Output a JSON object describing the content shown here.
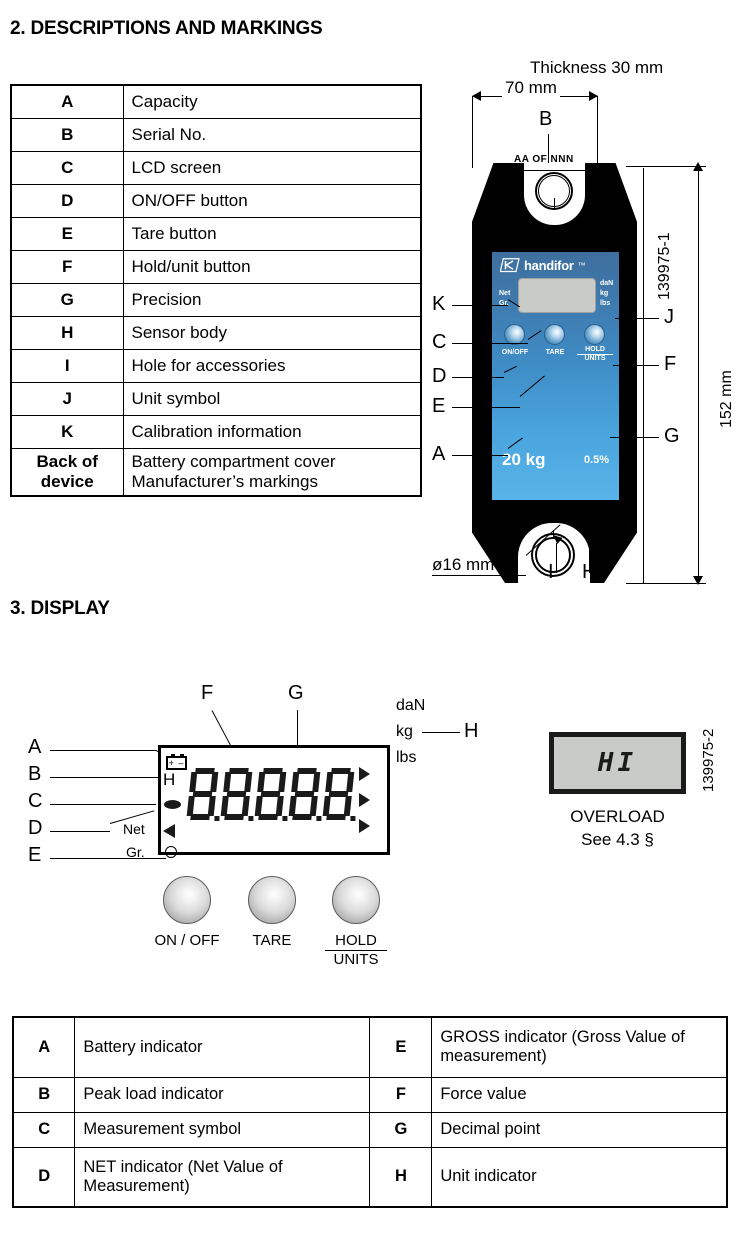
{
  "sections": {
    "descriptions_heading": "2. DESCRIPTIONS AND MARKINGS",
    "display_heading": "3. DISPLAY"
  },
  "markings_table": {
    "rows": [
      {
        "key": "A",
        "desc": "Capacity"
      },
      {
        "key": "B",
        "desc": "Serial No."
      },
      {
        "key": "C",
        "desc": "LCD screen"
      },
      {
        "key": "D",
        "desc": "ON/OFF button"
      },
      {
        "key": "E",
        "desc": "Tare button"
      },
      {
        "key": "F",
        "desc": "Hold/unit button"
      },
      {
        "key": "G",
        "desc": "Precision"
      },
      {
        "key": "H",
        "desc": "Sensor body"
      },
      {
        "key": "I",
        "desc": "Hole for accessories"
      },
      {
        "key": "J",
        "desc": "Unit symbol"
      },
      {
        "key": "K",
        "desc": "Calibration information"
      }
    ],
    "back_row": {
      "key_line1": "Back of",
      "key_line2": "device",
      "desc_line1": "Battery compartment cover",
      "desc_line2": "Manufacturer’s markings"
    }
  },
  "device_figure": {
    "thickness_label": "Thickness 30 mm",
    "width_label": "70 mm",
    "height_label": "152 mm",
    "hole_label": "ø16 mm",
    "drawing_ref": "139975-1",
    "serial_marking": "AA OF NNN",
    "brand_name": "handifor",
    "brand_tm": "™",
    "capacity_value": "20 kg",
    "precision_value": "0.5%",
    "net_label": "Net",
    "gr_label": "Gr.",
    "unit_dan": "daN",
    "unit_kg": "kg",
    "unit_lbs": "lbs",
    "btn_onoff": "ON/OFF",
    "btn_tare": "TARE",
    "btn_hold": "HOLD",
    "btn_units": "UNITS",
    "callouts": {
      "B": "B",
      "K": "K",
      "C": "C",
      "D": "D",
      "E": "E",
      "A": "A",
      "J": "J",
      "F": "F",
      "G": "G",
      "I": "I",
      "H": "H"
    },
    "colors": {
      "faceplate_top": "#3e6f9e",
      "faceplate_bottom": "#58b4e8",
      "body": "#000000",
      "lcd": "#c9cbc8"
    }
  },
  "display_figure": {
    "digits": "8.8.8.8.8",
    "digit_count": 5,
    "unit_dan": "daN",
    "unit_kg": "kg",
    "unit_lbs": "lbs",
    "peak_label": "H",
    "net_label": "Net",
    "gr_label": "Gr.",
    "callouts": {
      "A": "A",
      "B": "B",
      "C": "C",
      "D": "D",
      "E": "E",
      "F": "F",
      "G": "G",
      "H": "H"
    },
    "battery_symbol": "+ –",
    "buttons": [
      {
        "label": "ON / OFF",
        "label2": ""
      },
      {
        "label": "TARE",
        "label2": ""
      },
      {
        "label": "HOLD",
        "label2": "UNITS"
      }
    ],
    "overload": {
      "display_text": "HI",
      "caption_line1": "OVERLOAD",
      "caption_line2": "See 4.3 §",
      "drawing_ref": "139975-2"
    }
  },
  "legend_table": {
    "rows": [
      {
        "k1": "A",
        "d1": "Battery indicator",
        "k2": "E",
        "d2": "GROSS indicator (Gross Value of measurement)",
        "tall": true
      },
      {
        "k1": "B",
        "d1": "Peak load indicator",
        "k2": "F",
        "d2": "Force value",
        "tall": false
      },
      {
        "k1": "C",
        "d1": "Measurement symbol",
        "k2": "G",
        "d2": "Decimal point",
        "tall": false
      },
      {
        "k1": "D",
        "d1": "NET indicator (Net Value of Measurement)",
        "k2": "H",
        "d2": "Unit indicator",
        "tall": true
      }
    ]
  }
}
